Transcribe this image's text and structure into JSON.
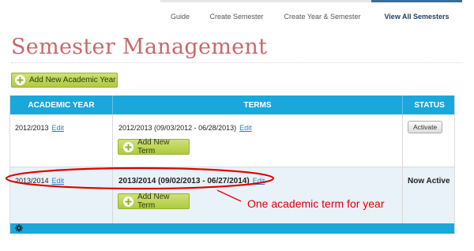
{
  "tabs": [
    {
      "label": "Guide"
    },
    {
      "label": "Create Semester"
    },
    {
      "label": "Create Year & Semester"
    },
    {
      "label": "View All Semesters",
      "active": true
    }
  ],
  "page_title": "Semester Management",
  "add_year_button": "Add New Academic Year",
  "table": {
    "headers": [
      "ACADEMIC YEAR",
      "TERMS",
      "STATUS"
    ],
    "rows": [
      {
        "year": "2012/2013",
        "year_edit": "Edit",
        "term": "2012/2013 (09/03/2012 - 06/28/2013)",
        "term_edit": "Edit",
        "add_term": "Add New Term",
        "status_button": "Activate"
      },
      {
        "year": "2013/2014",
        "year_edit": "Edit",
        "term": "2013/2014 (09/02/2013 - 06/27/2014)",
        "term_edit": "Edit",
        "add_term": "Add New Term",
        "status_text": "Now Active"
      }
    ]
  },
  "annotation": "One academic term for year",
  "colors": {
    "header_blue": "#1aa7db",
    "title_red": "#c8686b",
    "button_green": "#aecb3c",
    "annotation_red": "#e00000",
    "active_row": "#e9f1f9"
  },
  "icons": [
    "plus-circle-icon",
    "gear-icon"
  ]
}
